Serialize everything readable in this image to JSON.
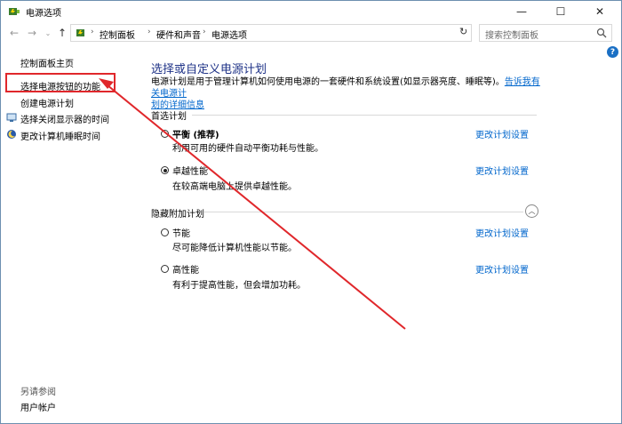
{
  "window": {
    "title": "电源选项",
    "min": "—",
    "max": "☐",
    "close": "✕"
  },
  "address": {
    "breadcrumbs": [
      "控制面板",
      "硬件和声音",
      "电源选项"
    ],
    "search_placeholder": "搜索控制面板"
  },
  "sidebar": {
    "home": "控制面板主页",
    "items": [
      "选择电源按钮的功能",
      "创建电源计划",
      "选择关闭显示器的时间",
      "更改计算机睡眠时间"
    ],
    "see_also_title": "另请参阅",
    "see_also_items": [
      "用户帐户"
    ]
  },
  "main": {
    "title": "选择或自定义电源计划",
    "description": "电源计划是用于管理计算机如何使用电源的一套硬件和系统设置(如显示器亮度、睡眠等)。",
    "description_link_1": "告诉我有关电源计",
    "description_link_2": "划的详细信息",
    "preferred_section": "首选计划",
    "hidden_section": "隐藏附加计划",
    "plans": [
      {
        "name": "平衡 (推荐)",
        "desc": "利用可用的硬件自动平衡功耗与性能。",
        "change": "更改计划设置",
        "selected": false
      },
      {
        "name": "卓越性能",
        "desc": "在较高端电脑上提供卓越性能。",
        "change": "更改计划设置",
        "selected": true
      },
      {
        "name": "节能",
        "desc": "尽可能降低计算机性能以节能。",
        "change": "更改计划设置",
        "selected": false
      },
      {
        "name": "高性能",
        "desc": "有利于提高性能，但会增加功耗。",
        "change": "更改计划设置",
        "selected": false
      }
    ]
  },
  "colors": {
    "accent_red": "#e0272b",
    "link": "#0066cc",
    "heading": "#1e3287"
  }
}
